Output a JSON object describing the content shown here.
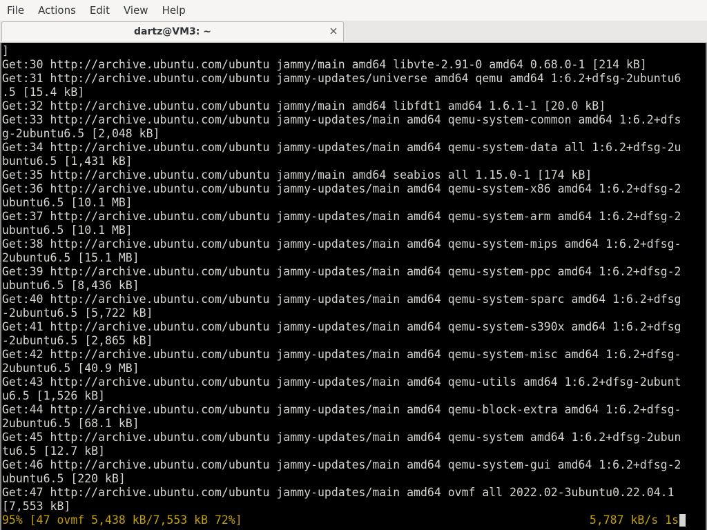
{
  "menubar": {
    "items": [
      "File",
      "Actions",
      "Edit",
      "View",
      "Help"
    ]
  },
  "tab": {
    "title": "dartz@VM3: ~"
  },
  "terminal": {
    "lines": [
      "]",
      "Get:30 http://archive.ubuntu.com/ubuntu jammy/main amd64 libvte-2.91-0 amd64 0.68.0-1 [214 kB]",
      "Get:31 http://archive.ubuntu.com/ubuntu jammy-updates/universe amd64 qemu amd64 1:6.2+dfsg-2ubuntu6",
      ".5 [15.4 kB]",
      "Get:32 http://archive.ubuntu.com/ubuntu jammy/main amd64 libfdt1 amd64 1.6.1-1 [20.0 kB]",
      "Get:33 http://archive.ubuntu.com/ubuntu jammy-updates/main amd64 qemu-system-common amd64 1:6.2+dfs",
      "g-2ubuntu6.5 [2,048 kB]",
      "Get:34 http://archive.ubuntu.com/ubuntu jammy-updates/main amd64 qemu-system-data all 1:6.2+dfsg-2u",
      "buntu6.5 [1,431 kB]",
      "Get:35 http://archive.ubuntu.com/ubuntu jammy/main amd64 seabios all 1.15.0-1 [174 kB]",
      "Get:36 http://archive.ubuntu.com/ubuntu jammy-updates/main amd64 qemu-system-x86 amd64 1:6.2+dfsg-2",
      "ubuntu6.5 [10.1 MB]",
      "Get:37 http://archive.ubuntu.com/ubuntu jammy-updates/main amd64 qemu-system-arm amd64 1:6.2+dfsg-2",
      "ubuntu6.5 [10.1 MB]",
      "Get:38 http://archive.ubuntu.com/ubuntu jammy-updates/main amd64 qemu-system-mips amd64 1:6.2+dfsg-",
      "2ubuntu6.5 [15.1 MB]",
      "Get:39 http://archive.ubuntu.com/ubuntu jammy-updates/main amd64 qemu-system-ppc amd64 1:6.2+dfsg-2",
      "ubuntu6.5 [8,436 kB]",
      "Get:40 http://archive.ubuntu.com/ubuntu jammy-updates/main amd64 qemu-system-sparc amd64 1:6.2+dfsg",
      "-2ubuntu6.5 [5,722 kB]",
      "Get:41 http://archive.ubuntu.com/ubuntu jammy-updates/main amd64 qemu-system-s390x amd64 1:6.2+dfsg",
      "-2ubuntu6.5 [2,865 kB]",
      "Get:42 http://archive.ubuntu.com/ubuntu jammy-updates/main amd64 qemu-system-misc amd64 1:6.2+dfsg-",
      "2ubuntu6.5 [40.9 MB]",
      "Get:43 http://archive.ubuntu.com/ubuntu jammy-updates/main amd64 qemu-utils amd64 1:6.2+dfsg-2ubunt",
      "u6.5 [1,526 kB]",
      "Get:44 http://archive.ubuntu.com/ubuntu jammy-updates/main amd64 qemu-block-extra amd64 1:6.2+dfsg-",
      "2ubuntu6.5 [68.1 kB]",
      "Get:45 http://archive.ubuntu.com/ubuntu jammy-updates/main amd64 qemu-system amd64 1:6.2+dfsg-2ubun",
      "tu6.5 [12.7 kB]",
      "Get:46 http://archive.ubuntu.com/ubuntu jammy-updates/main amd64 qemu-system-gui amd64 1:6.2+dfsg-2",
      "ubuntu6.5 [220 kB]",
      "Get:47 http://archive.ubuntu.com/ubuntu jammy-updates/main amd64 ovmf all 2022.02-3ubuntu0.22.04.1",
      "[7,553 kB]"
    ],
    "status_left": "95% [47 ovmf 5,438 kB/7,553 kB 72%]",
    "status_right": "5,787 kB/s 1s"
  },
  "colors": {
    "terminal_bg": "#000000",
    "terminal_fg": "#d3d7cf",
    "status_fg": "#c4a000"
  },
  "icons": {
    "tab_close": "close-icon"
  }
}
